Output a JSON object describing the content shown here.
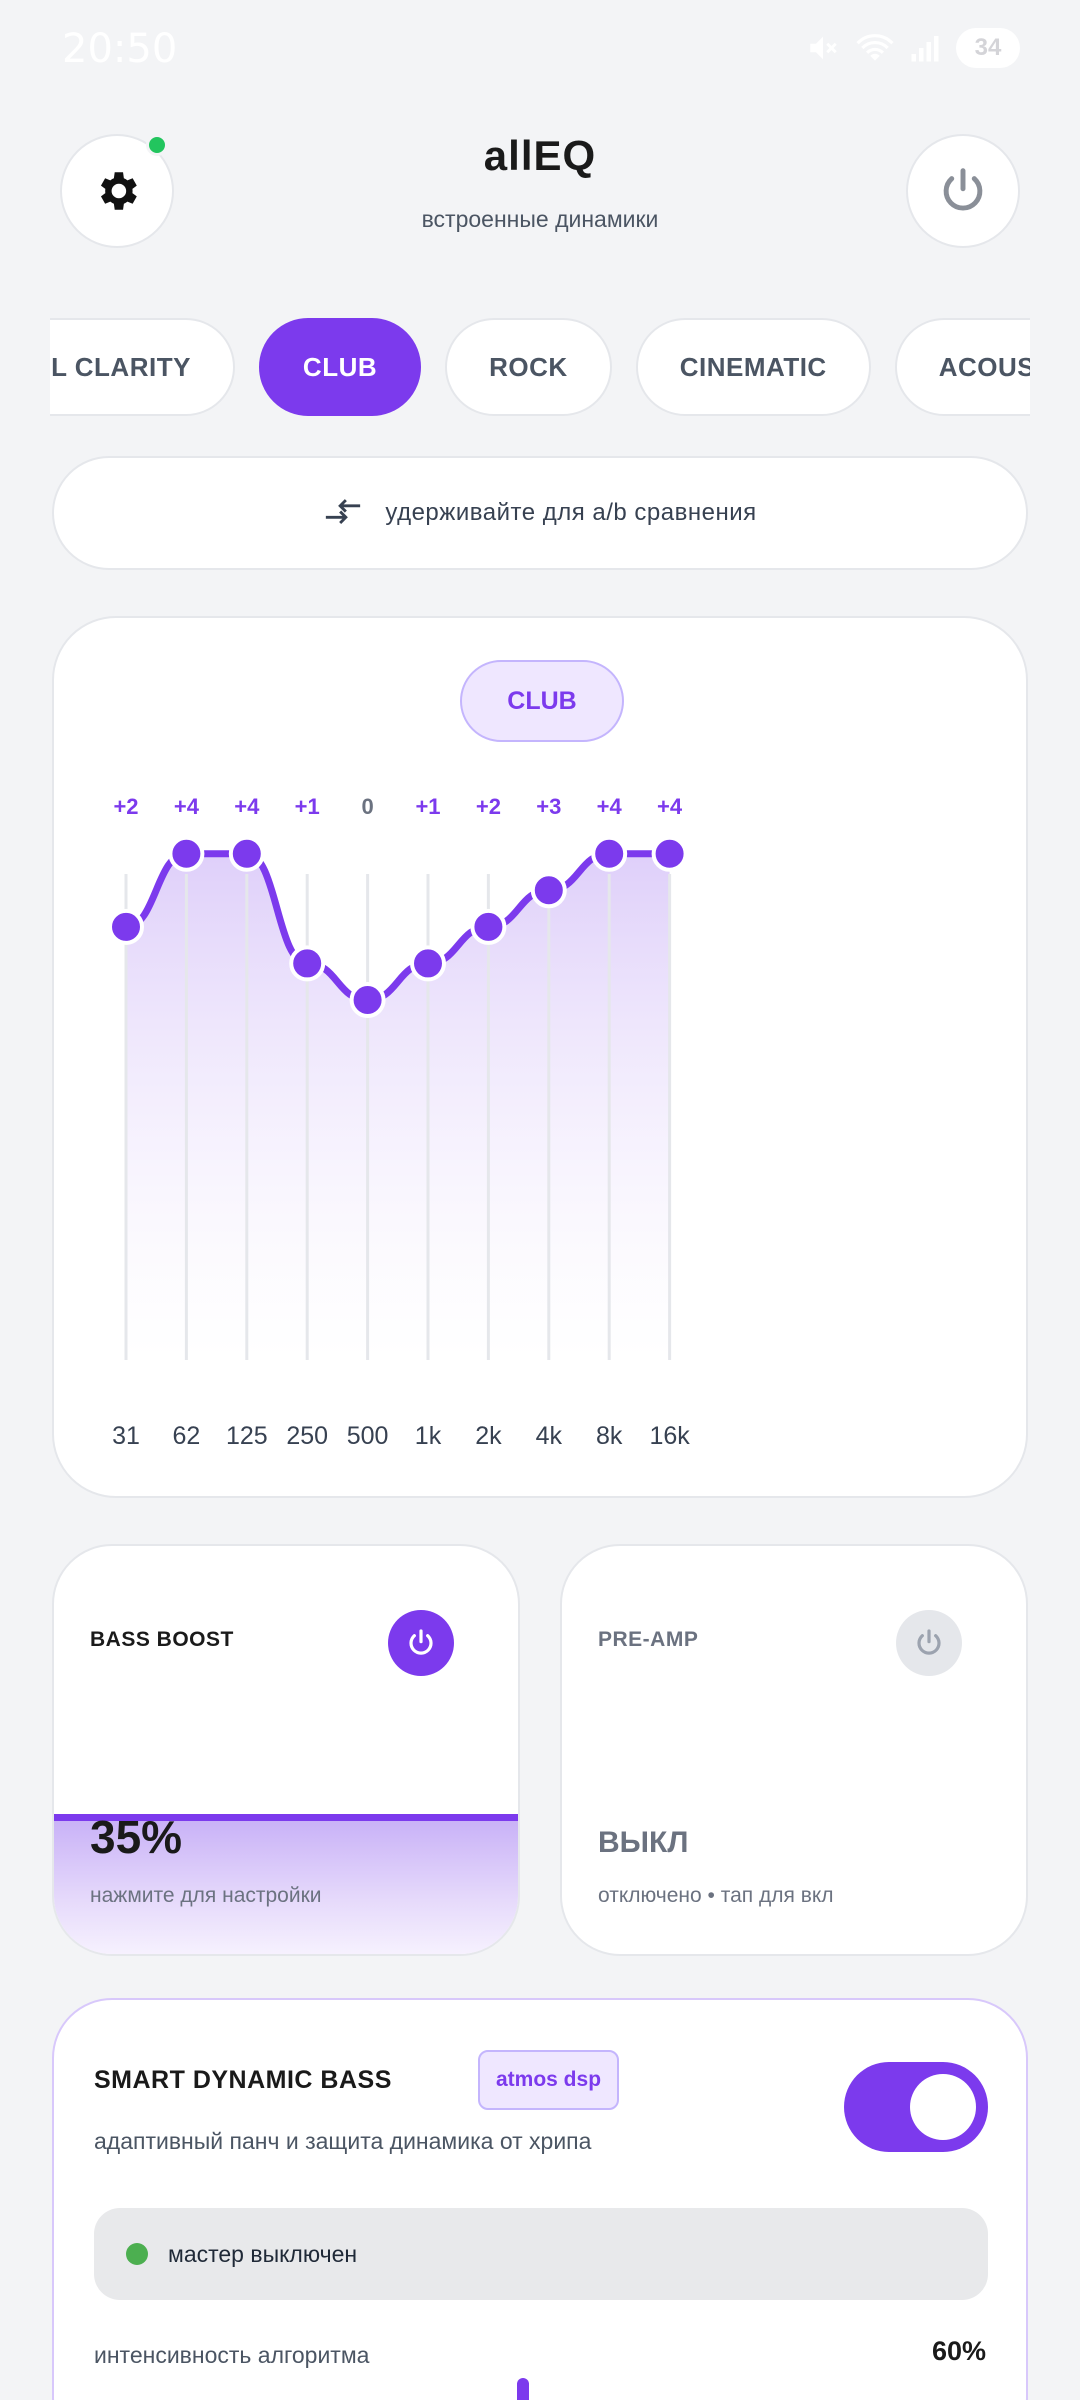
{
  "status": {
    "time": "20:50",
    "battery": "34"
  },
  "header": {
    "title": "allEQ",
    "subtitle": "встроенные динамики"
  },
  "presets": [
    {
      "label": "VOCAL CLARITY",
      "active": false
    },
    {
      "label": "CLUB",
      "active": true
    },
    {
      "label": "ROCK",
      "active": false
    },
    {
      "label": "CINEMATIC",
      "active": false
    },
    {
      "label": "ACOUSTIC",
      "active": false
    }
  ],
  "ab": {
    "label": "удерживайте для a/b сравнения"
  },
  "eq": {
    "preset": "CLUB",
    "bands": [
      {
        "freq": "31",
        "gain": 2,
        "label": "+2"
      },
      {
        "freq": "62",
        "gain": 4,
        "label": "+4"
      },
      {
        "freq": "125",
        "gain": 4,
        "label": "+4"
      },
      {
        "freq": "250",
        "gain": 1,
        "label": "+1"
      },
      {
        "freq": "500",
        "gain": 0,
        "label": "0"
      },
      {
        "freq": "1k",
        "gain": 1,
        "label": "+1"
      },
      {
        "freq": "2k",
        "gain": 2,
        "label": "+2"
      },
      {
        "freq": "4k",
        "gain": 3,
        "label": "+3"
      },
      {
        "freq": "8k",
        "gain": 4,
        "label": "+4"
      },
      {
        "freq": "16k",
        "gain": 4,
        "label": "+4"
      }
    ],
    "gain_range": [
      -12,
      12
    ],
    "accent": "#7c3aed"
  },
  "bass_boost": {
    "label": "BASS BOOST",
    "value": "35%",
    "level": 0.35,
    "hint": "нажмите для настройки",
    "enabled": true
  },
  "preamp": {
    "label": "PRE-AMP",
    "value": "ВЫКЛ",
    "hint": "отключено • тап для вкл",
    "enabled": false
  },
  "smart_bass": {
    "title": "SMART DYNAMIC BASS",
    "badge": "atmos dsp",
    "description": "адаптивный панч и защита динамика от хрипа",
    "enabled": true,
    "master_status": "мастер выключен",
    "intensity_label": "интенсивность алгоритма",
    "intensity_value": "60%",
    "intensity": 0.6
  },
  "colors": {
    "accent": "#7c3aed",
    "accent_light": "#efe7ff",
    "background": "#f3f4f6",
    "status_green": "#4caf50"
  }
}
